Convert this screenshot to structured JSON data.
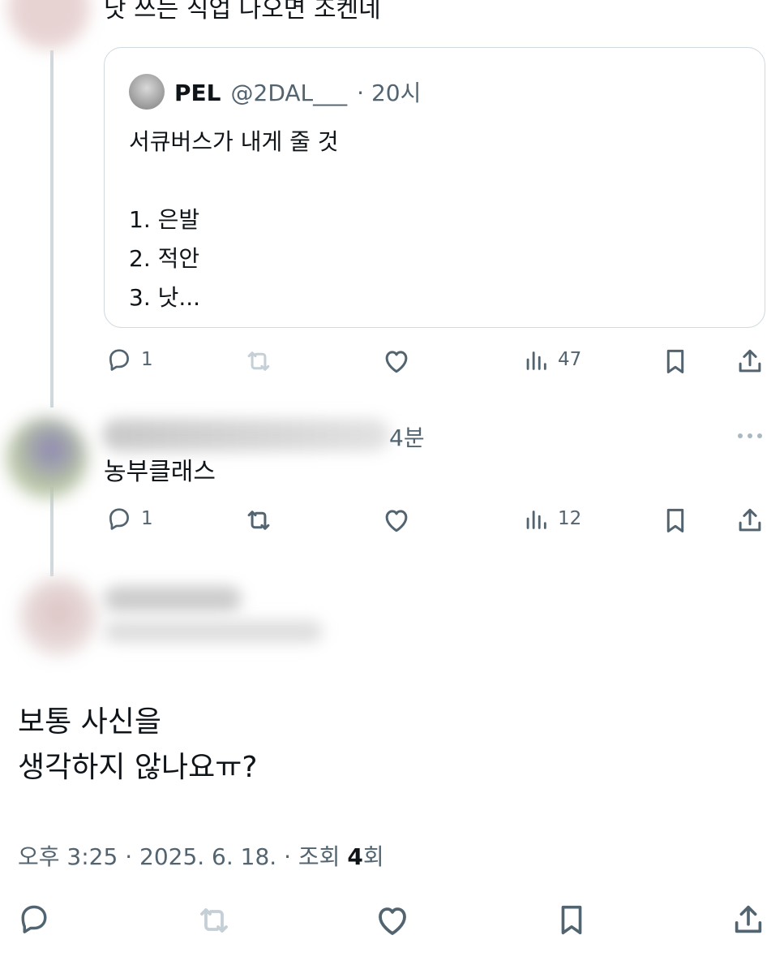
{
  "top_tweet": {
    "text": "낫 쓰는 직업 나오면 조켄네"
  },
  "quoted_tweet": {
    "display_name": "PEL",
    "handle": "@2DAL___",
    "time": "· 20시",
    "lines": [
      "서큐버스가 내게 줄 것",
      "",
      "1. 은발",
      "2. 적안",
      "3. 낫..."
    ]
  },
  "top_actions": {
    "reply_count": "1",
    "retweet_count": "",
    "like_count": "",
    "views_count": "47"
  },
  "reply_tweet": {
    "time": "4분",
    "text": "농부클래스"
  },
  "reply_actions": {
    "reply_count": "1",
    "retweet_count": "",
    "like_count": "",
    "views_count": "12"
  },
  "main_tweet": {
    "line1": "보통 사신을",
    "line2": "생각하지 않나요ㅠ?"
  },
  "main_meta": {
    "prefix": "오후 3:25 · 2025. 6. 18. · 조회 ",
    "views": "4",
    "suffix": "회"
  },
  "colors": {
    "text": "#0f1419",
    "secondary": "#536471",
    "divider": "#cfd9de",
    "retweet_disabled": "#c4cfd6"
  },
  "icons": [
    "reply-icon",
    "retweet-icon",
    "like-icon",
    "views-icon",
    "bookmark-icon",
    "share-icon",
    "more-icon"
  ]
}
